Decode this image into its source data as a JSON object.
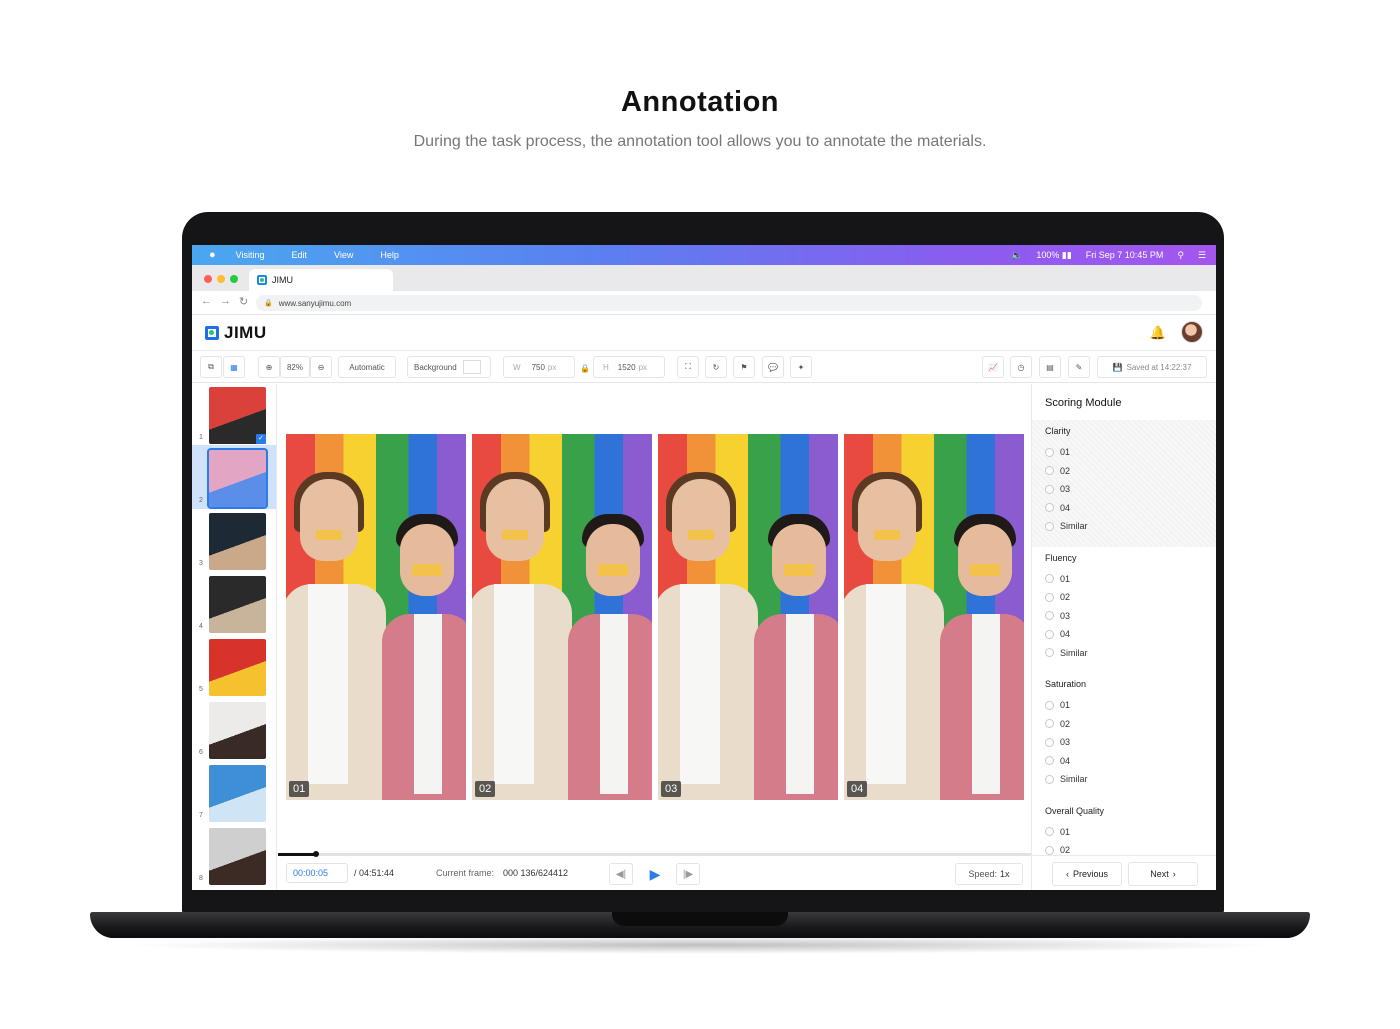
{
  "page": {
    "title": "Annotation",
    "subtitle": "During the task process, the annotation tool allows you to annotate the materials."
  },
  "menubar": {
    "items": [
      "Visiting",
      "Edit",
      "View",
      "Help"
    ],
    "battery": "100%",
    "datetime": "Fri Sep 7 10:45 PM"
  },
  "browser": {
    "tab_title": "JIMU",
    "url": "www.sanyujimu.com"
  },
  "app": {
    "logo_text": "JIMU"
  },
  "toolbar": {
    "zoom": "82%",
    "mode": "Automatic",
    "background_label": "Background",
    "width_label": "W",
    "width_value": "750",
    "height_label": "H",
    "height_value": "1520",
    "unit": "px",
    "saved_status": "Saved at 14:22:37"
  },
  "thumbnails": [
    {
      "num": "1",
      "colors": [
        "#d9413a",
        "#2a2a2a"
      ],
      "checked": true
    },
    {
      "num": "2",
      "colors": [
        "#e2a6c4",
        "#5a8ee8"
      ],
      "selected": true
    },
    {
      "num": "3",
      "colors": [
        "#1d2a36",
        "#c9a98a"
      ]
    },
    {
      "num": "4",
      "colors": [
        "#2a2a2a",
        "#c8b49a"
      ]
    },
    {
      "num": "5",
      "colors": [
        "#d7332b",
        "#f5c12e"
      ]
    },
    {
      "num": "6",
      "colors": [
        "#ecebe9",
        "#3a2a25"
      ]
    },
    {
      "num": "7",
      "colors": [
        "#3f8fd6",
        "#cfe5f5"
      ]
    },
    {
      "num": "8",
      "colors": [
        "#cfcfcf",
        "#3b2b24"
      ]
    }
  ],
  "frames": [
    "01",
    "02",
    "03",
    "04"
  ],
  "playback": {
    "current_time": "00:00:05",
    "total_time": "/ 04:51:44",
    "frame_label": "Current frame:",
    "frame_value": "000 136/624412",
    "speed_label": "Speed:",
    "speed_value": "1x",
    "progress": 0.05
  },
  "scoring": {
    "title": "Scoring Module",
    "groups": [
      {
        "name": "Clarity",
        "options": [
          "01",
          "02",
          "03",
          "04",
          "Similar"
        ]
      },
      {
        "name": "Fluency",
        "options": [
          "01",
          "02",
          "03",
          "04",
          "Similar"
        ]
      },
      {
        "name": "Saturation",
        "options": [
          "01",
          "02",
          "03",
          "04",
          "Similar"
        ]
      },
      {
        "name": "Overall Quality",
        "options": [
          "01",
          "02"
        ]
      }
    ],
    "previous_label": "Previous",
    "next_label": "Next"
  },
  "colors": {
    "accent": "#2b7be8",
    "menubar_start": "#4aa7f0",
    "menubar_end": "#a356ee"
  }
}
